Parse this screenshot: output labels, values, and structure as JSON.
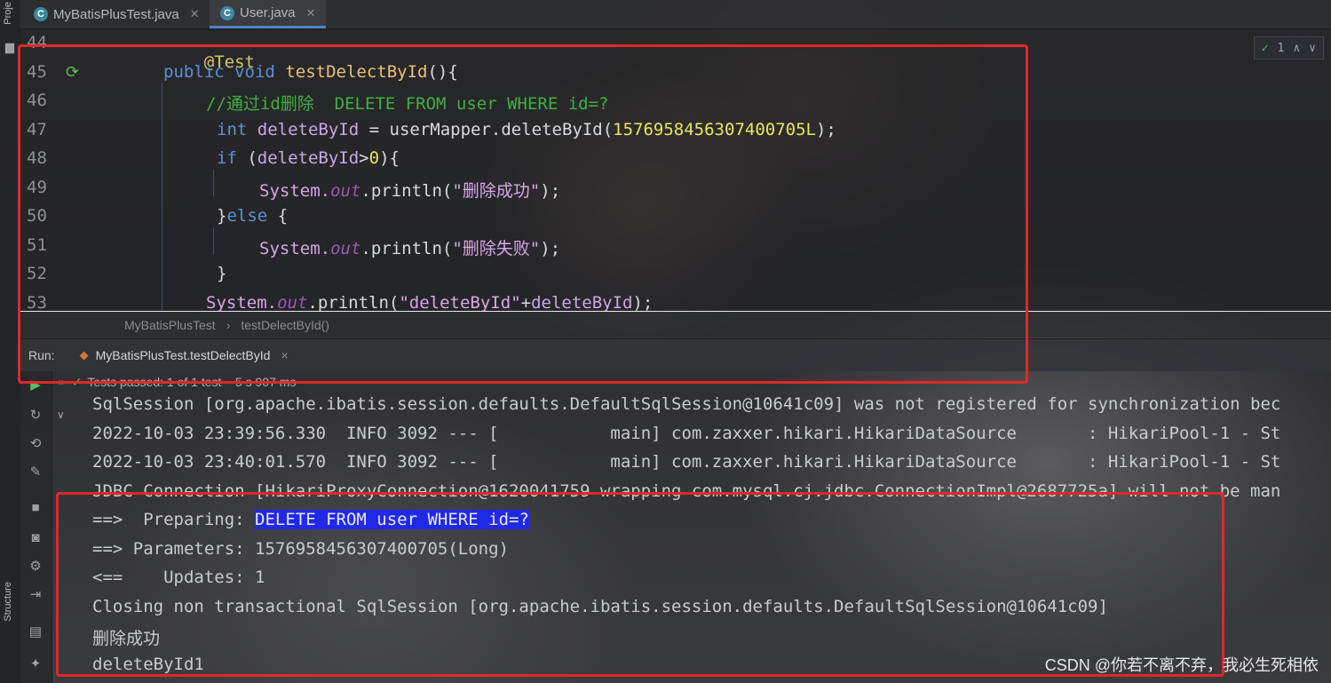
{
  "sidebar": {
    "project_label": "Proje",
    "structure_label": "Structure"
  },
  "tabs": [
    {
      "icon": "C",
      "label": "MyBatisPlusTest.java",
      "active": false
    },
    {
      "icon": "C",
      "label": "User.java",
      "active": true
    }
  ],
  "inspection": {
    "count": "1"
  },
  "editor": {
    "line_numbers": [
      "44",
      "45",
      "46",
      "47",
      "48",
      "49",
      "50",
      "51",
      "52",
      "53"
    ],
    "lines": [
      {
        "annotation": "@Test"
      },
      {
        "kw1": "public",
        "kw2": "void",
        "method": "testDelectById",
        "rest": "(){"
      },
      {
        "comment": "//通过id删除  DELETE FROM user WHERE id=?"
      },
      {
        "type": "int",
        "var": "deleteById",
        "eq": " = ",
        "call": "userMapper.deleteById(",
        "num": "1576958456307400705L",
        "end": ");"
      },
      {
        "kw": "if",
        "open": " (",
        "var": "deleteById",
        "cond": ">",
        "num": "0",
        "close": "){"
      },
      {
        "cls": "System.",
        "field": "out",
        "call": ".println(",
        "str": "\"删除成功\"",
        "end": ");"
      },
      {
        "text1": "}",
        "kw": "else",
        "text2": " {"
      },
      {
        "cls": "System.",
        "field": "out",
        "call": ".println(",
        "str": "\"删除失败\"",
        "end": ");"
      },
      {
        "text": "}"
      },
      {
        "cls": "System.",
        "field": "out",
        "call": ".println(",
        "str": "\"deleteById\"",
        "plus": "+",
        "var": "deleteById",
        "end": ");"
      }
    ]
  },
  "breadcrumb": {
    "class": "MyBatisPlusTest",
    "sep": "›",
    "method": "testDelectById()"
  },
  "run": {
    "label": "Run:",
    "config": "MyBatisPlusTest.testDelectById",
    "close": "×"
  },
  "test_status": {
    "text": "Tests passed: 1 of 1 test – 5 s 907 ms"
  },
  "console": {
    "lines": [
      "SqlSession [org.apache.ibatis.session.defaults.DefaultSqlSession@10641c09] was not registered for synchronization bec",
      "2022-10-03 23:39:56.330  INFO 3092 --- [           main] com.zaxxer.hikari.HikariDataSource       : HikariPool-1 - St",
      "2022-10-03 23:40:01.570  INFO 3092 --- [           main] com.zaxxer.hikari.HikariDataSource       : HikariPool-1 - St",
      "JDBC Connection [HikariProxyConnection@1620041759 wrapping com.mysql.cj.jdbc.ConnectionImpl@2687725a] will not be man"
    ],
    "preparing_prefix": "==>  Preparing: ",
    "preparing_sql": "DELETE FROM user WHERE id=?",
    "parameters": "==> Parameters: 1576958456307400705(Long)",
    "updates": "<==    Updates: 1",
    "closing": "Closing non transactional SqlSession [org.apache.ibatis.session.defaults.DefaultSqlSession@10641c09]",
    "result_cn": "删除成功",
    "result_print": "deleteById1"
  },
  "watermark": "CSDN @你若不离不弃，我必生死相依",
  "colors": {
    "highlight": "#2129e8",
    "annotation_box": "#e0282a",
    "comment": "#3eb043",
    "number": "#e8e85c"
  }
}
